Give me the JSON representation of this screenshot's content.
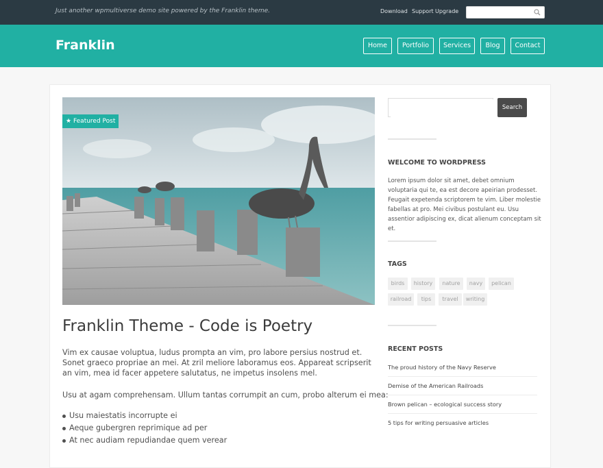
{
  "topbar": {
    "tagline": "Just another wpmultiverse demo site powered by the Franklin theme.",
    "links": [
      "Download",
      "Support",
      "Upgrade"
    ],
    "search_placeholder": ""
  },
  "header": {
    "logo": "Franklin",
    "nav": [
      "Home",
      "Portfolio",
      "Services",
      "Blog",
      "Contact"
    ]
  },
  "post": {
    "badge": "Featured Post",
    "title": "Franklin Theme - Code is Poetry",
    "paragraph1": "Vim ex causae voluptua, ludus prompta an vim, pro labore persius nostrud et. Sonet graeco propriae an mei. At zril meliore laboramus eos. Appareat scripserit an vim, mea id facer appetere salutatus, ne impetus insolens mel.",
    "paragraph2": "Usu at agam comprehensam. Ullum tantas corrumpit an cum, probo alterum ei mea:",
    "list": [
      "Usu maiestatis incorrupte ei",
      "Aeque gubergren reprimique ad per",
      "At nec audiam repudiandae quem verear"
    ]
  },
  "sidebar": {
    "search_button": "Search",
    "welcome_title": "WELCOME TO WORDPRESS",
    "welcome_text": "Lorem ipsum dolor sit amet, debet omnium voluptaria qui te, ea est decore apeirian prodesset. Feugait expetenda scriptorem te vim. Liber molestie fabellas at pro. Mei civibus postulant eu. Usu assentior adipiscing ex, dicat alienum conceptam sit et.",
    "tags_title": "TAGS",
    "tags": [
      "birds",
      "history",
      "nature",
      "navy",
      "pelican",
      "railroad",
      "tips",
      "travel",
      "writing"
    ],
    "recent_title": "RECENT POSTS",
    "recent": [
      "The proud history of the Navy Reserve",
      "Demise of the American Railroads",
      "Brown pelican – ecological success story",
      "5 tips for writing persuasive articles"
    ]
  },
  "colors": {
    "topbar": "#2b3a43",
    "accent": "#21b0a3",
    "button_dark": "#4a4a4a"
  }
}
